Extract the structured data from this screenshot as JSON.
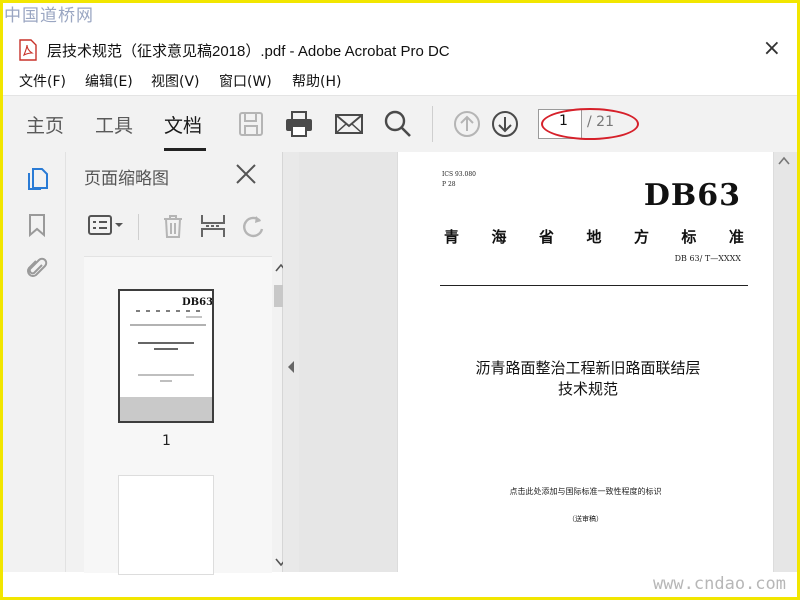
{
  "watermark": {
    "top": "中国道桥网",
    "bottom": "www.cndao.com"
  },
  "window": {
    "title": "层技术规范（征求意见稿2018）.pdf - Adobe Acrobat Pro DC",
    "close": "×"
  },
  "menu": [
    "文件(F)",
    "编辑(E)",
    "视图(V)",
    "窗口(W)",
    "帮助(H)"
  ],
  "tabs": {
    "home": "主页",
    "tools": "工具",
    "document": "文档"
  },
  "page_nav": {
    "current": "1",
    "total": "/ 21"
  },
  "annotation_color": "#d6202a",
  "thumbnail_panel": {
    "title": "页面缩略图",
    "page_label": "1"
  },
  "document": {
    "ics": "ICS 93.080",
    "p": "P 28",
    "code": "DB63",
    "province_chars": [
      "青",
      "海",
      "省",
      "地",
      "方",
      "标",
      "准"
    ],
    "std_no": "DB 63/ T—XXXX",
    "title_line1": "沥青路面整治工程新旧路面联结层",
    "title_line2": "技术规范",
    "note": "点击此处添加与国际标准一致性程度的标识",
    "draft": "（送审稿）"
  }
}
